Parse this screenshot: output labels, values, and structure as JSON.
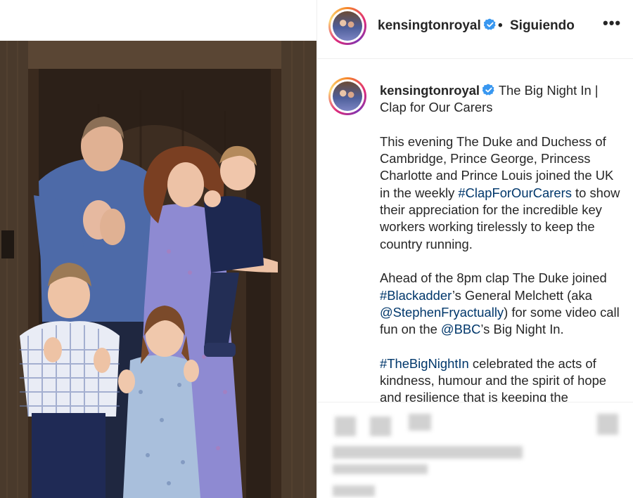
{
  "post": {
    "username": "kensingtonroyal",
    "separator": "•",
    "follow_status": "Siguiendo",
    "more_label": "•••",
    "verified_icon": "verified-badge-icon",
    "accent_color": "#00376b",
    "verified_color": "#3897f0"
  },
  "caption": {
    "username": "kensingtonroyal",
    "title": "The Big Night In | Clap for Our Carers",
    "p1_a": "This evening The Duke and Duchess of Cambridge, Prince George, Princess Charlotte and Prince Louis joined the UK in the weekly ",
    "p1_tag": "#ClapForOurCarers",
    "p1_b": " to show their appreciation for the incredible key workers working tirelessly to keep the country running.",
    "p2_a": "Ahead of the 8pm clap The Duke joined ",
    "p2_tag1": "#Blackadder",
    "p2_b": "’s General Melchett (aka ",
    "p2_tag2": "@StephenFryactually",
    "p2_c": ") for some video call fun on the ",
    "p2_tag3": "@BBC",
    "p2_d": "’s Big Night In.",
    "p3_tag": "#TheBigNightIn",
    "p3_b": " celebrated the acts of kindness, humour and the spirit of hope and resilience that is keeping the"
  }
}
